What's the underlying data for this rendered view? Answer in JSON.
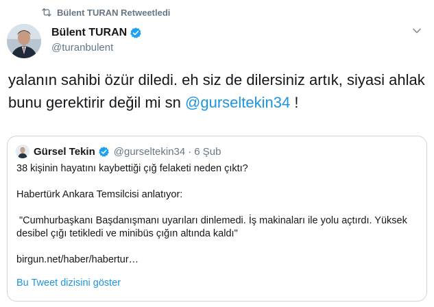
{
  "retweet": {
    "label": "Bülent TURAN Retweetledi",
    "icon": "retweet-icon"
  },
  "author": {
    "name": "Bülent TURAN",
    "handle": "@turanbulent",
    "verified": true
  },
  "tweet": {
    "text_before_mention": "yalanın sahibi özür diledi. eh siz de dilersiniz artık, siyasi ahlak bunu gerektirir değil mi sn ",
    "mention": "@gurseltekin34",
    "text_after_mention": " !"
  },
  "quoted": {
    "name": "Gürsel Tekin",
    "handle": "@gurseltekin34",
    "dot": "·",
    "date": "6 Şub",
    "paragraphs": [
      "38 kişinin hayatını kaybettiği çığ felaketi neden çıktı?",
      "Habertürk Ankara Temsilcisi anlatıyor:",
      " \"Cumhurbaşkanı Başdanışmanı uyarıları dinlemedi. İş makinaları ile yolu açtırdı. Yüksek desibel çığı tetikledi ve minibüs çığın altında kaldı\"",
      "birgun.net/haber/habertur…"
    ],
    "show_thread": "Bu Tweet dizisini göster"
  },
  "colors": {
    "link": "#1b95e0",
    "secondary_text": "#657786",
    "verified": "#1da1f2",
    "border": "#ccd6dd"
  }
}
